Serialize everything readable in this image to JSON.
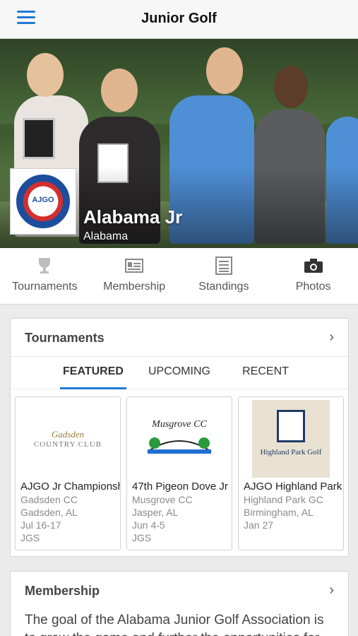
{
  "nav": {
    "title": "Junior Golf",
    "menu_icon": "hamburger-icon",
    "accent": "#1f7ad6"
  },
  "hero": {
    "title": "Alabama Jr",
    "subtitle": "Alabama",
    "logo_text": "AJGO",
    "logo_arc_text": "ALABAMA JUNIOR GOLF ASSOCIATION"
  },
  "tabs": [
    {
      "label": "Tournaments",
      "icon": "trophy-icon"
    },
    {
      "label": "Membership",
      "icon": "id-card-icon"
    },
    {
      "label": "Standings",
      "icon": "list-icon"
    },
    {
      "label": "Photos",
      "icon": "camera-icon"
    }
  ],
  "tournaments": {
    "header": "Tournaments",
    "segments": [
      "FEATURED",
      "UPCOMING",
      "RECENT"
    ],
    "active_segment": "FEATURED",
    "items": [
      {
        "name": "AJGO Jr Championship",
        "course": "Gadsden CC",
        "location": "Gadsden, AL",
        "dates": "Jul 16-17",
        "org": "JGS",
        "logo_line1": "Gadsden",
        "logo_line2": "COUNTRY CLUB"
      },
      {
        "name": "47th Pigeon Dove Jr",
        "course": "Musgrove CC",
        "location": "Jasper, AL",
        "dates": "Jun 4-5",
        "org": "JGS",
        "logo_text": "Musgrove CC"
      },
      {
        "name": "AJGO Highland Park",
        "course": "Highland Park GC",
        "location": "Birmingham, AL",
        "dates": "Jan 27",
        "org": "",
        "logo_text": "Highland Park Golf"
      }
    ]
  },
  "membership": {
    "header": "Membership",
    "text": "The goal of the Alabama Junior Golf Association is to grow the game and further the opportunities for"
  }
}
